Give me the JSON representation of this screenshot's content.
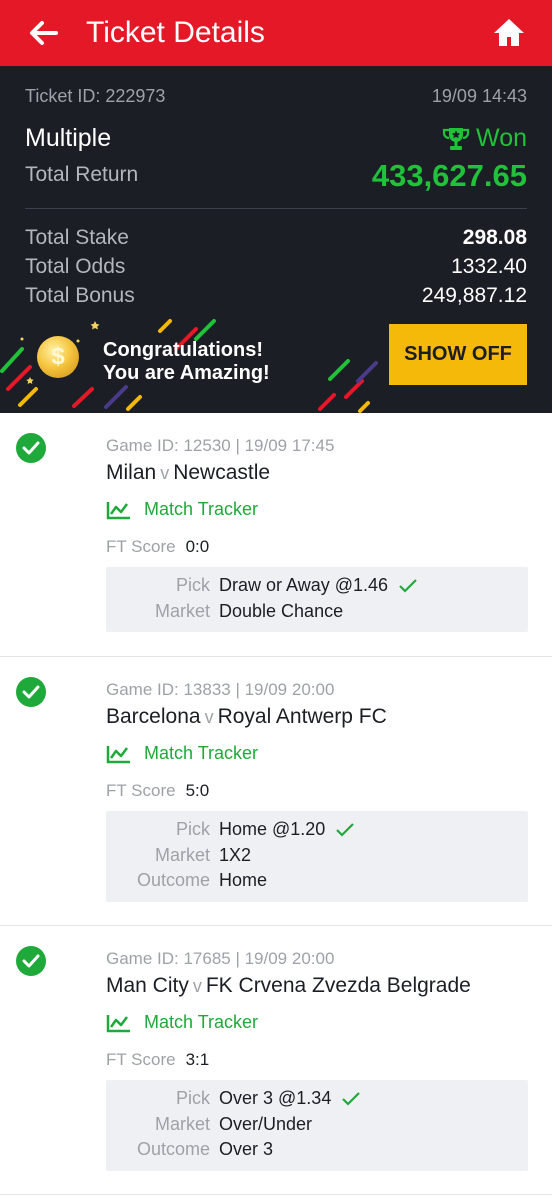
{
  "header": {
    "title": "Ticket Details"
  },
  "ticket": {
    "id_label": "Ticket ID: 222973",
    "date": "19/09 14:43",
    "type": "Multiple",
    "status": "Won",
    "total_return_label": "Total Return",
    "total_return": "433,627.65",
    "total_stake_label": "Total Stake",
    "total_stake": "298.08",
    "total_odds_label": "Total Odds",
    "total_odds": "1332.40",
    "total_bonus_label": "Total Bonus",
    "total_bonus": "249,887.12"
  },
  "promo": {
    "line1": "Congratulations!",
    "line2": "You are Amazing!",
    "button": "SHOW OFF"
  },
  "games": [
    {
      "game_id": "Game ID: 12530 | 19/09 17:45",
      "home": "Milan",
      "vs": "v",
      "away": "Newcastle",
      "tracker": "Match Tracker",
      "ft_label": "FT Score",
      "ft_score": "0:0",
      "pick_label": "Pick",
      "pick": "Draw or Away @1.46",
      "market_label": "Market",
      "market": "Double Chance"
    },
    {
      "game_id": "Game ID: 13833 | 19/09 20:00",
      "home": "Barcelona",
      "vs": "v",
      "away": "Royal Antwerp FC",
      "tracker": "Match Tracker",
      "ft_label": "FT Score",
      "ft_score": "5:0",
      "pick_label": "Pick",
      "pick": "Home @1.20",
      "market_label": "Market",
      "market": "1X2",
      "outcome_label": "Outcome",
      "outcome": "Home"
    },
    {
      "game_id": "Game ID: 17685 | 19/09 20:00",
      "home": "Man City",
      "vs": "v",
      "away": "FK Crvena Zvezda Belgrade",
      "tracker": "Match Tracker",
      "ft_label": "FT Score",
      "ft_score": "3:1",
      "pick_label": "Pick",
      "pick": "Over 3 @1.34",
      "market_label": "Market",
      "market": "Over/Under",
      "outcome_label": "Outcome",
      "outcome": "Over 3"
    }
  ],
  "colors": {
    "header": "#e41827",
    "panel": "#1b1e25",
    "win_green": "#21c13a",
    "accent_yellow": "#f5b90a"
  }
}
